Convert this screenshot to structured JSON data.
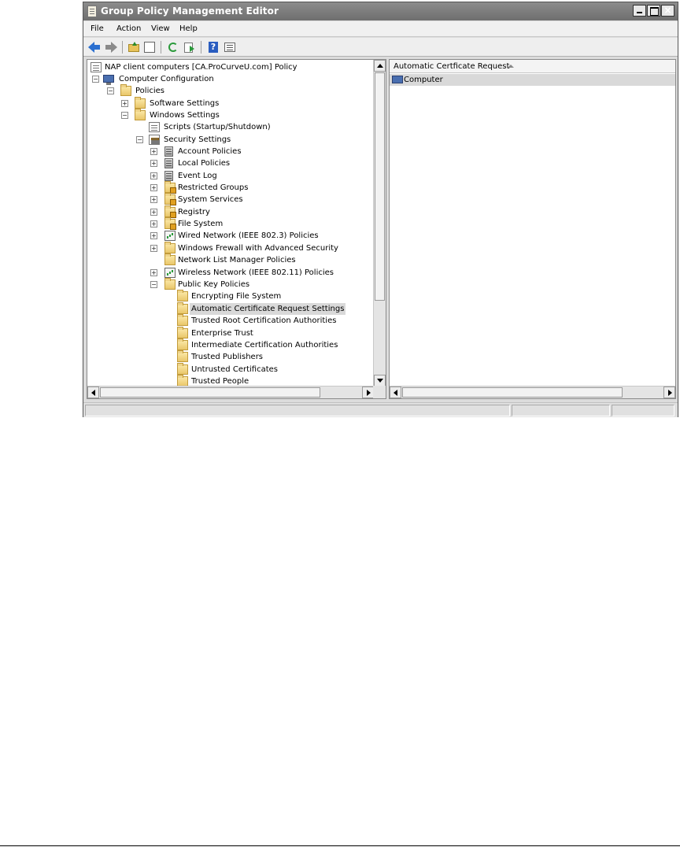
{
  "window": {
    "title": "Group Policy Management Editor"
  },
  "menu": [
    "File",
    "Action",
    "View",
    "Help"
  ],
  "toolbar": {
    "buttons": [
      "back-icon",
      "forward-icon",
      "up-one-level-icon",
      "show-hide-console-tree-icon",
      "refresh-icon",
      "export-list-icon",
      "help-icon",
      "properties-icon"
    ]
  },
  "tree": {
    "root": "NAP client computers [CA.ProCurveU.com] Policy",
    "computer_configuration": "Computer Configuration",
    "policies": "Policies",
    "software_settings": "Software Settings",
    "windows_settings": "Windows Settings",
    "scripts": "Scripts (Startup/Shutdown)",
    "security_settings": "Security Settings",
    "security_items": [
      "Account Policies",
      "Local Policies",
      "Event Log",
      "Restricted Groups",
      "System Services",
      "Registry",
      "File System",
      "Wired Network (IEEE 802.3) Policies",
      "Windows Frewall with Advanced Security",
      "Network List Manager Policies",
      "Wireless Network (IEEE 802.11) Policies",
      "Public Key Policies"
    ],
    "public_key_items": [
      "Encrypting File System",
      "Automatic Certificate Request Settings",
      "Trusted Root Certification Authorities",
      "Enterprise Trust",
      "Intermediate Certification Authorities",
      "Trusted Publishers",
      "Untrusted Certificates",
      "Trusted People"
    ]
  },
  "right_pane": {
    "column_header": "Automatic Certficate Request",
    "rows": [
      "Computer"
    ]
  },
  "colors": {
    "titlebar": "#7a7a7a",
    "selection": "#d9d9d9",
    "folder": "#f0cf70"
  }
}
